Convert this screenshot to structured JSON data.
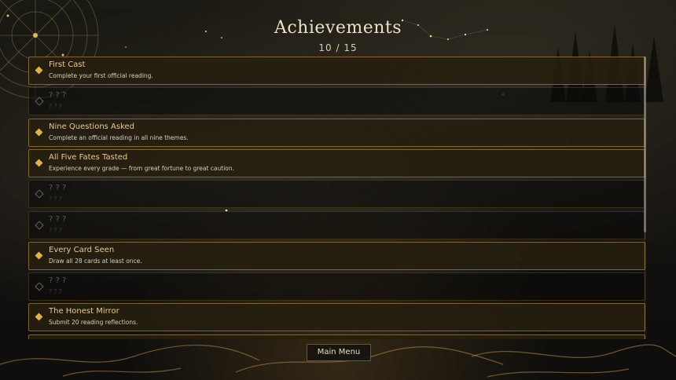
{
  "header": {
    "title": "Achievements",
    "progress": "10 / 15"
  },
  "achievements": [
    {
      "name": "First Cast",
      "description": "Complete your first official reading.",
      "unlocked": true
    },
    {
      "name": "? ? ?",
      "description": "? ? ?",
      "unlocked": false
    },
    {
      "name": "Nine Questions Asked",
      "description": "Complete an official reading in all nine themes.",
      "unlocked": true
    },
    {
      "name": "All Five Fates Tasted",
      "description": "Experience every grade — from great fortune to great caution.",
      "unlocked": true
    },
    {
      "name": "? ? ?",
      "description": "? ? ?",
      "unlocked": false
    },
    {
      "name": "? ? ?",
      "description": "? ? ?",
      "unlocked": false
    },
    {
      "name": "Every Card Seen",
      "description": "Draw all 28 cards at least once.",
      "unlocked": true
    },
    {
      "name": "? ? ?",
      "description": "? ? ?",
      "unlocked": false
    },
    {
      "name": "The Honest Mirror",
      "description": "Submit 20 reading reflections.",
      "unlocked": true
    },
    {
      "name": "",
      "description": "",
      "unlocked": true
    }
  ],
  "footer": {
    "main_menu_label": "Main Menu"
  },
  "colors": {
    "accent": "#e1b14a",
    "unlocked_name": "#e9c98a",
    "locked_text": "#5c5a52"
  },
  "icons": {
    "unlocked": "filled-diamond-icon",
    "locked": "outline-diamond-icon"
  }
}
